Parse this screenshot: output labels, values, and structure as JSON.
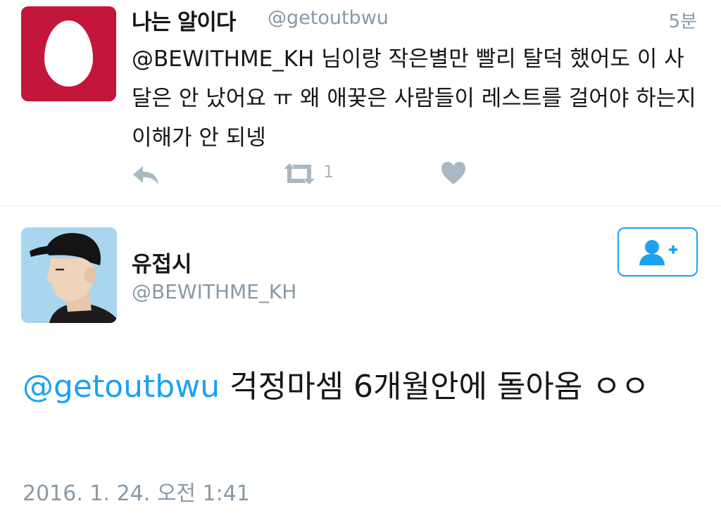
{
  "tweet1": {
    "author_name": "나는 알이다",
    "author_handle": "@getoutbwu",
    "time": "5분",
    "text": "@BEWITHME_KH 님이랑 작은별만 빨리 탈덕 했어도 이 사달은 안 났어요 ㅠ 왜 애꿎은 사람들이 레스트를 걸어야 하는지 이해가 안 되넹",
    "retweet_count": "1",
    "avatar_color": "#c4163a"
  },
  "tweet2": {
    "author_name": "유접시",
    "author_handle": "@BEWITHME_KH",
    "mention": "@getoutbwu",
    "text": "걱정마셈 6개월안에 돌아옴 ㅇㅇ",
    "timestamp": "2016. 1. 24. 오전 1:41"
  },
  "colors": {
    "accent": "#1da1f2",
    "muted": "#8899a6",
    "icon": "#aab8c2"
  },
  "icons": {
    "reply": "reply-icon",
    "retweet": "retweet-icon",
    "like": "heart-icon",
    "follow": "add-user-icon",
    "avatar1": "egg-icon"
  }
}
